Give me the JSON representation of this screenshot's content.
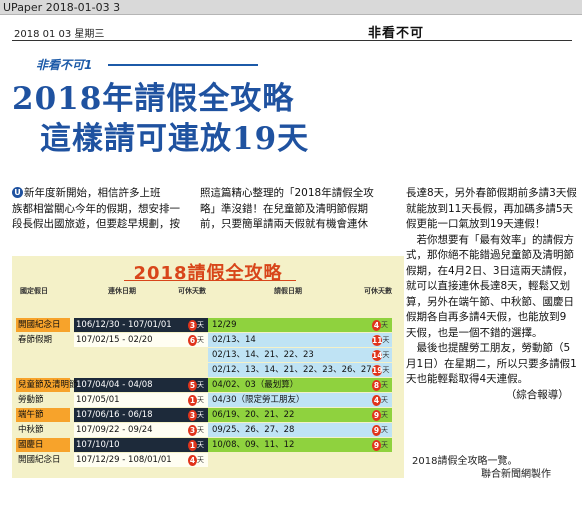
{
  "topbar": {
    "label": "UPaper 2018-01-03 3"
  },
  "header": {
    "dateline": "2018  01  03  星期三",
    "section": "非看不可"
  },
  "article": {
    "kicker": "非看不可1",
    "title_line1": "2018年請假全攻略",
    "title_line2": "這樣請可連放19天",
    "dropcap": "U",
    "col1": [
      "新年度新開始，相信許多上班",
      "族都相當關心今年的假期，想安排一",
      "段長假出國旅遊，但要趁早規劃，按"
    ],
    "col2": [
      "照這篇精心整理的「2018年請假全攻",
      "略」準沒錯！在兒童節及清明節假期",
      "前，只要簡單請兩天假就有機會連休"
    ],
    "col3": [
      "長達8天，另外春節假期前多請3天假",
      "就能放到11天長假，再加碼多請5天",
      "假更能一口氣放到19天連假！",
      "　若你想要有「最有效率」的請假方",
      "式，那你絕不能錯過兒童節及清明節",
      "假期，在4月2日、3日這兩天請假，",
      "就可以直接連休長達8天，輕鬆又划",
      "算，另外在端午節、中秋節、國慶日",
      "假期各自再多請4天假，也能放到9",
      "天假，也是一個不錯的選擇。",
      "　最後也提醒勞工朋友，勞動節（5",
      "月1日）在星期二，所以只要多請假1",
      "天也能輕鬆取得4天連假。",
      "　　　　　　　　　　（綜合報導）"
    ],
    "credit1": "2018請假全攻略一覽。",
    "credit2": "聯合新聞網製作"
  },
  "graphic": {
    "title": "2018請假全攻略",
    "headers": {
      "name": "國定假日",
      "date": "連休日期",
      "days": "可休天數",
      "alt": "請假日期",
      "days2": "可休天數"
    },
    "rows": [
      {
        "name": "開國紀念日",
        "date": "106/12/30 - 107/01/01",
        "days": "3",
        "days_unit": "天",
        "alt": "12/29",
        "days2": "4",
        "days2_unit": "天"
      },
      {
        "name": "春節假期",
        "date": "107/02/15 - 02/20",
        "days": "6",
        "days_unit": "天",
        "alt": "02/13、14",
        "days2": "11",
        "days2_unit": "天"
      },
      {
        "name": "",
        "date": "",
        "days": "",
        "days_unit": "",
        "alt": "02/13、14、21、22、23",
        "days2": "14",
        "days2_unit": "天"
      },
      {
        "name": "",
        "date": "",
        "days": "",
        "days_unit": "",
        "alt": "02/12、13、14、21、22、23、26、27",
        "days2": "19",
        "days2_unit": "天"
      },
      {
        "name": "兒童節及清明節",
        "date": "107/04/04 - 04/08",
        "days": "5",
        "days_unit": "天",
        "alt": "04/02、03（最划算）",
        "days2": "8",
        "days2_unit": "天"
      },
      {
        "name": "勞動節",
        "date": "107/05/01",
        "days": "1",
        "days_unit": "天",
        "alt": "04/30（限定勞工朋友）",
        "days2": "4",
        "days2_unit": "天"
      },
      {
        "name": "端午節",
        "date": "107/06/16 - 06/18",
        "days": "3",
        "days_unit": "天",
        "alt": "06/19、20、21、22",
        "days2": "9",
        "days2_unit": "天"
      },
      {
        "name": "中秋節",
        "date": "107/09/22 - 09/24",
        "days": "3",
        "days_unit": "天",
        "alt": "09/25、26、27、28",
        "days2": "9",
        "days2_unit": "天"
      },
      {
        "name": "國慶日",
        "date": "107/10/10",
        "days": "1",
        "days_unit": "天",
        "alt": "10/08、09、11、12",
        "days2": "9",
        "days2_unit": "天"
      },
      {
        "name": "開國紀念日",
        "date": "107/12/29 - 108/01/01",
        "days": "4",
        "days_unit": "天",
        "alt": "",
        "days2": "",
        "days2_unit": ""
      }
    ]
  }
}
